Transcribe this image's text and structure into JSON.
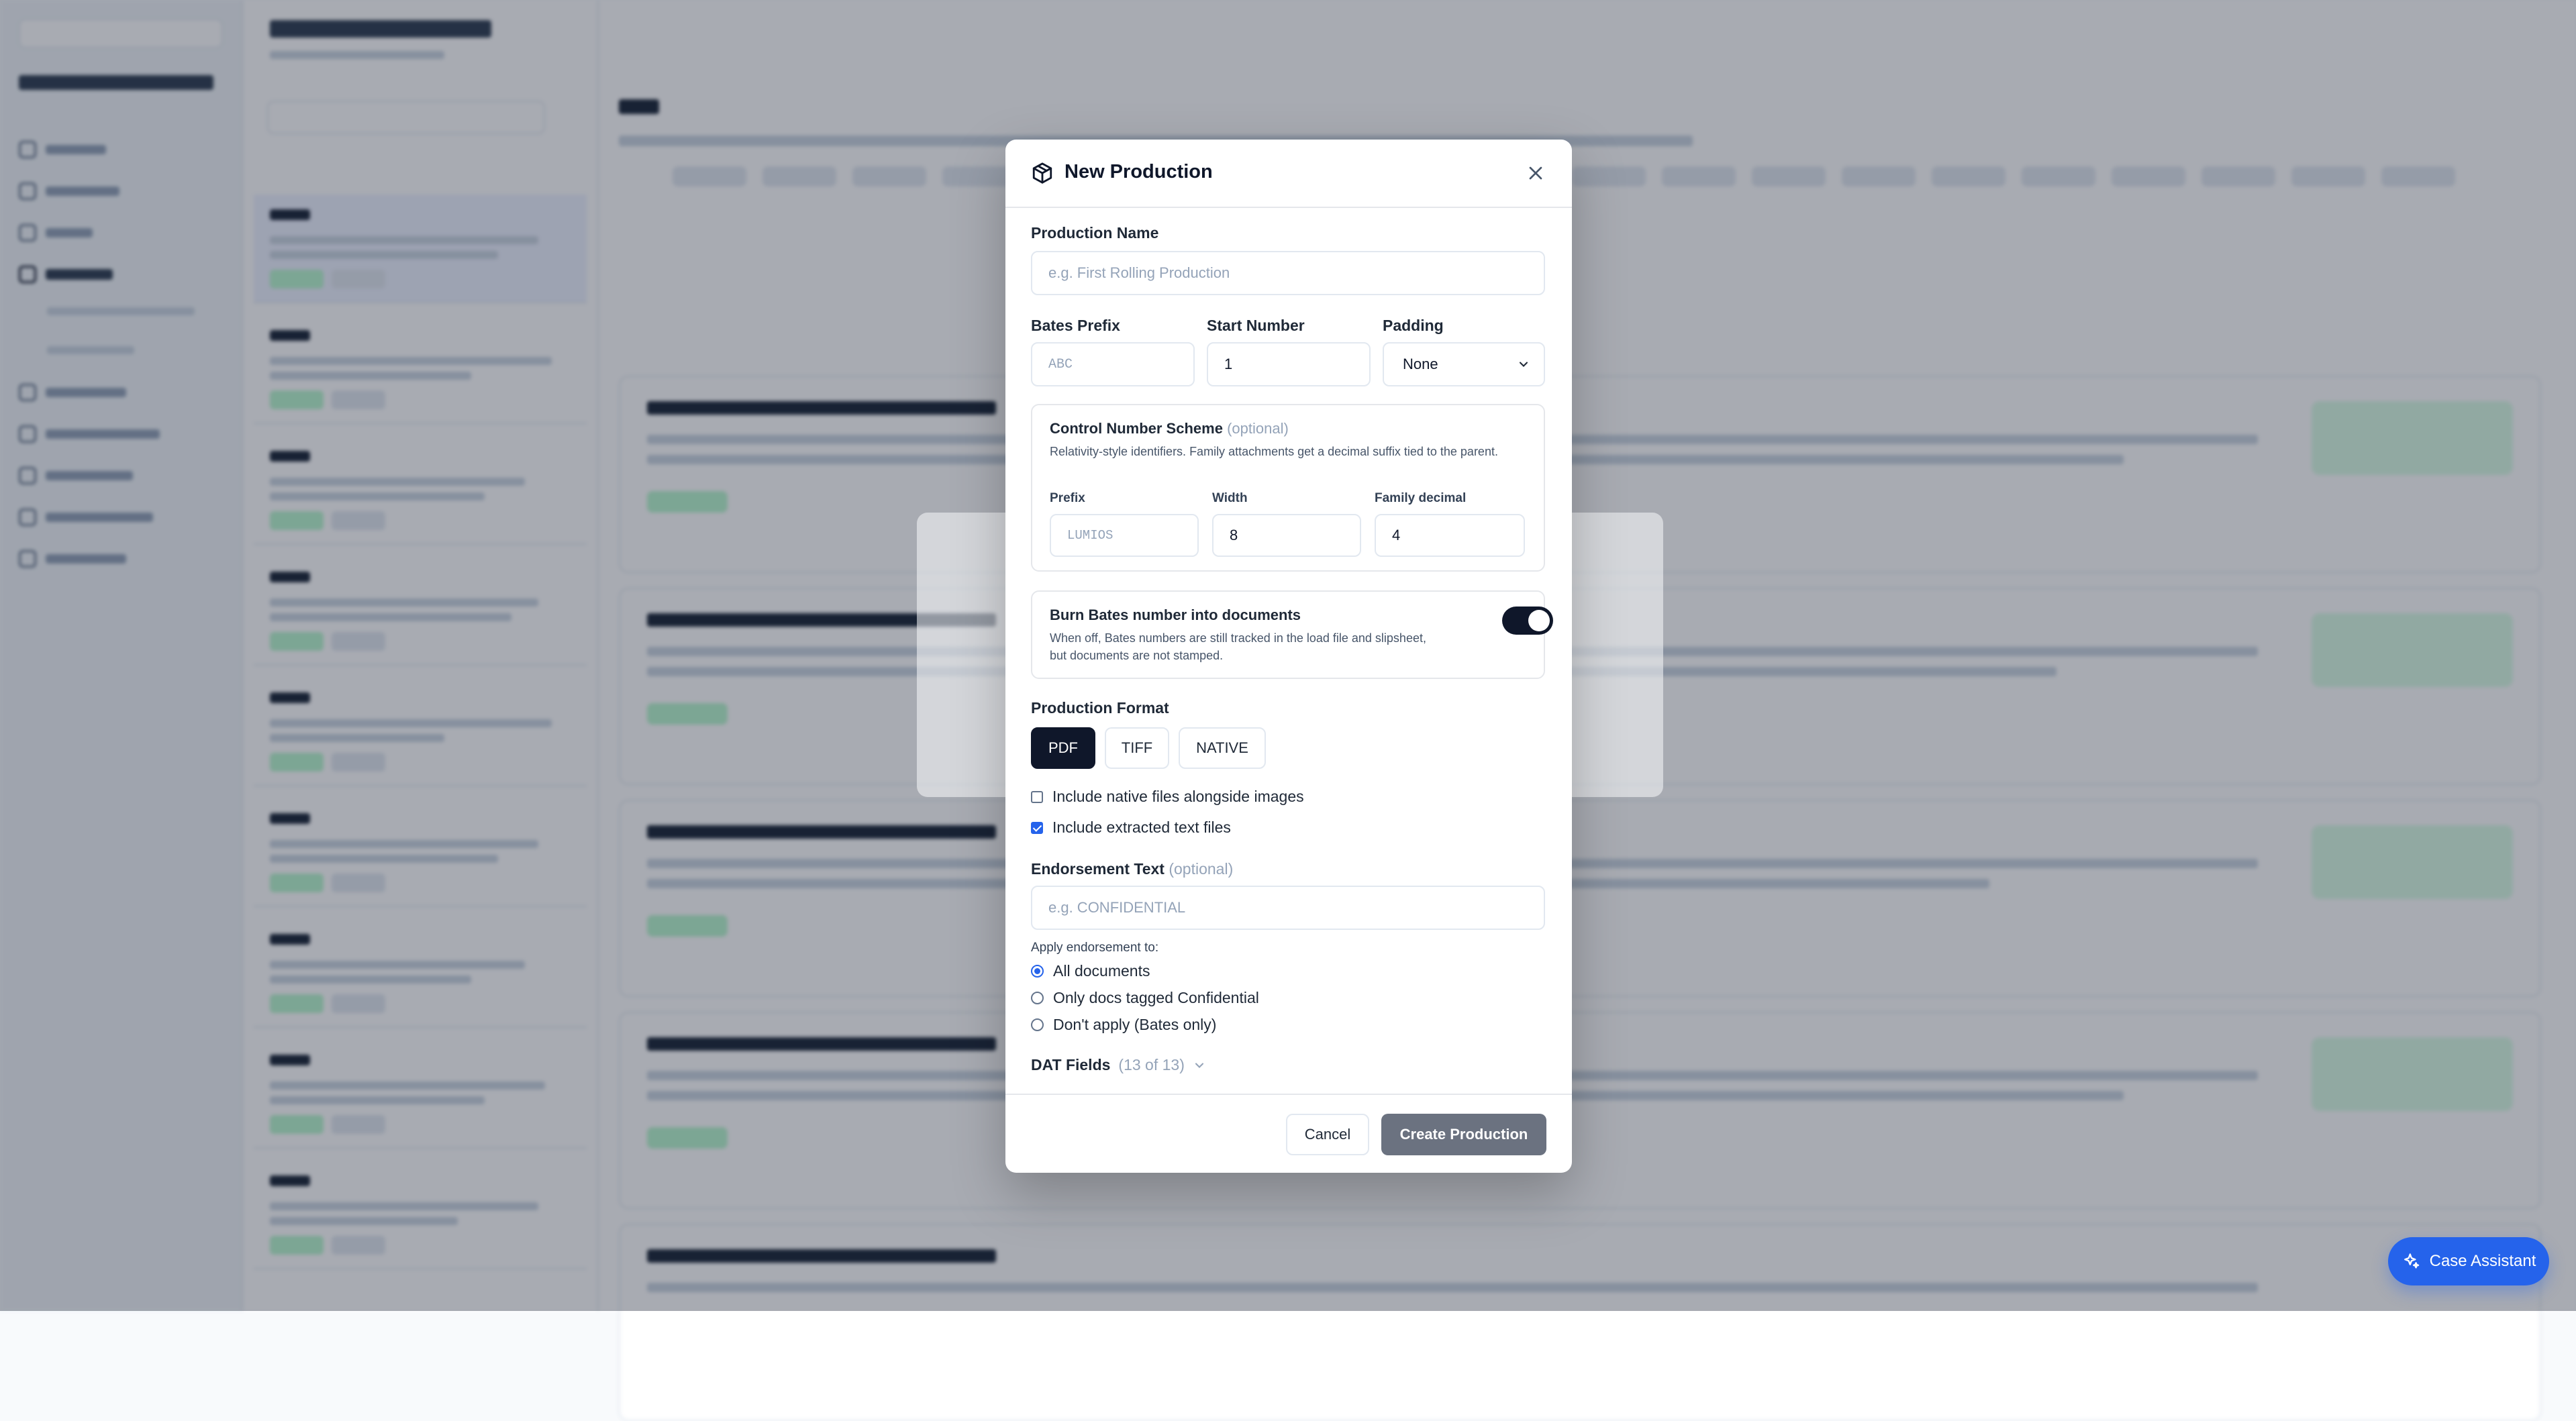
{
  "modal": {
    "title": "New Production",
    "title_icon": "package-icon",
    "close_icon": "close-icon",
    "production_name": {
      "label": "Production Name",
      "placeholder": "e.g. First Rolling Production",
      "value": ""
    },
    "bates_prefix": {
      "label": "Bates Prefix",
      "placeholder": "ABC",
      "value": ""
    },
    "start_number": {
      "label": "Start Number",
      "value": "1"
    },
    "padding": {
      "label": "Padding",
      "selected": "None",
      "chevron_icon": "chevron-down-icon"
    },
    "control_number": {
      "title": "Control Number Scheme",
      "optional": "(optional)",
      "description": "Relativity-style identifiers. Family attachments get a decimal suffix tied to the parent.",
      "prefix": {
        "label": "Prefix",
        "placeholder": "LUMIOS",
        "value": ""
      },
      "width": {
        "label": "Width",
        "value": "8"
      },
      "family_decimal": {
        "label": "Family decimal",
        "value": "4"
      }
    },
    "burn_bates": {
      "title": "Burn Bates number into documents",
      "description": "When off, Bates numbers are still tracked in the load file and slipsheet, but documents are not stamped.",
      "enabled": true
    },
    "production_format": {
      "label": "Production Format",
      "options": [
        "PDF",
        "TIFF",
        "NATIVE"
      ],
      "selected": "PDF"
    },
    "checkboxes": [
      {
        "label": "Include native files alongside images",
        "checked": false
      },
      {
        "label": "Include extracted text files",
        "checked": true
      }
    ],
    "endorsement": {
      "label": "Endorsement Text",
      "optional": "(optional)",
      "placeholder": "e.g. CONFIDENTIAL",
      "value": ""
    },
    "apply_endorsement": {
      "label": "Apply endorsement to:",
      "options": [
        "All documents",
        "Only docs tagged Confidential",
        "Don't apply (Bates only)"
      ],
      "selected": "All documents"
    },
    "dat_fields": {
      "label": "DAT Fields",
      "count": "(13 of 13)",
      "chevron_icon": "chevron-down-icon"
    },
    "footer": {
      "cancel": "Cancel",
      "create": "Create Production"
    }
  },
  "assistant_button": {
    "label": "Case Assistant",
    "icon": "sparkles-icon"
  },
  "colors": {
    "primary_dark": "#0f172a",
    "accent_blue": "#2563eb",
    "create_disabled": "#6b7280",
    "overlay": "#0f172a5c"
  }
}
